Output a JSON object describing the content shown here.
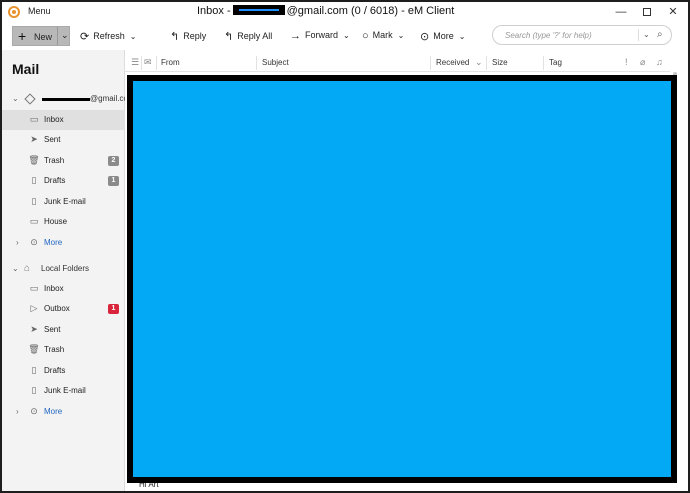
{
  "titlebar": {
    "menu_label": "Menu",
    "title_prefix": "Inbox -",
    "title_suffix": "@gmail.com (0 / 6018) - eM Client",
    "minimize": "—",
    "close": "✕"
  },
  "toolbar": {
    "new_label": "New",
    "refresh_label": "Refresh",
    "reply_label": "Reply",
    "reply_all_label": "Reply All",
    "forward_label": "Forward",
    "mark_label": "Mark",
    "more_label": "More",
    "search_placeholder": "Search (type '?' for help)"
  },
  "sidebar": {
    "title": "Mail",
    "account_suffix": "@gmail.com",
    "account_items": [
      {
        "label": "Inbox",
        "icon": "inbox-icon"
      },
      {
        "label": "Sent",
        "icon": "send-icon"
      },
      {
        "label": "Trash",
        "icon": "trash-icon",
        "badge": "2"
      },
      {
        "label": "Drafts",
        "icon": "draft-icon",
        "badge": "1"
      },
      {
        "label": "Junk E-mail",
        "icon": "junk-icon"
      },
      {
        "label": "House",
        "icon": "folder-icon"
      },
      {
        "label": "More",
        "icon": "more-icon"
      }
    ],
    "local_folders_label": "Local Folders",
    "local_items": [
      {
        "label": "Inbox",
        "icon": "inbox-icon"
      },
      {
        "label": "Outbox",
        "icon": "outbox-icon",
        "badge": "1"
      },
      {
        "label": "Sent",
        "icon": "send-icon"
      },
      {
        "label": "Trash",
        "icon": "trash-icon"
      },
      {
        "label": "Drafts",
        "icon": "draft-icon"
      },
      {
        "label": "Junk E-mail",
        "icon": "junk-icon"
      },
      {
        "label": "More",
        "icon": "more-icon"
      }
    ]
  },
  "list": {
    "columns": [
      "From",
      "Subject",
      "Received",
      "Size",
      "Tag"
    ],
    "preview_snippet": "Hi Art"
  },
  "colors": {
    "overlay": "#03a9f4",
    "badge_red": "#d9253b",
    "badge_gray": "#8a8a8a",
    "link_blue": "#1f66c2"
  }
}
